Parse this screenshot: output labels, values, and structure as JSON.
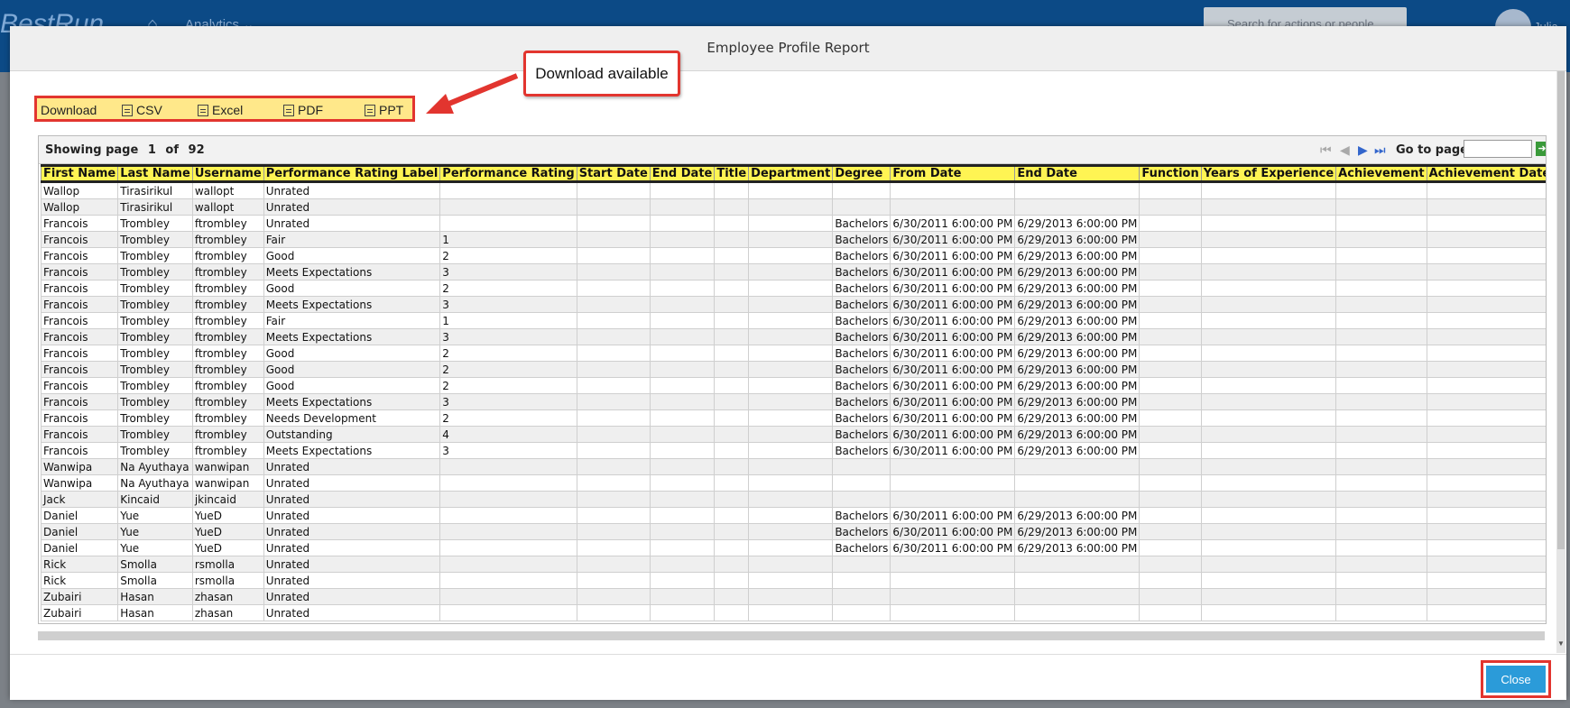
{
  "app": {
    "logo": "BestRun",
    "nav_label": "Analytics",
    "search_placeholder": "Search for actions or people",
    "user_name": "Julia M"
  },
  "dialog": {
    "title": "Employee Profile Report",
    "close_label": "Close"
  },
  "toolbar": {
    "download_label": "Download",
    "items": [
      "CSV",
      "Excel",
      "PDF",
      "PPT"
    ]
  },
  "callout": {
    "text": "Download available"
  },
  "paging": {
    "showing_label": "Showing page",
    "current_page": "1",
    "of_label": "of",
    "total_pages": "92",
    "goto_label": "Go to page:"
  },
  "table": {
    "columns": [
      "First Name",
      "Last Name",
      "Username",
      "Performance Rating Label",
      "Performance Rating",
      "Start Date",
      "End Date",
      "Title",
      "Department",
      "Degree",
      "From Date",
      "End Date",
      "Function",
      "Years of Experience",
      "Achievement",
      "Achievement Date"
    ],
    "rows": [
      [
        "Wallop",
        "Tirasirikul",
        "wallopt",
        "Unrated",
        "",
        "",
        "",
        "",
        "",
        "",
        "",
        "",
        "",
        "",
        "",
        ""
      ],
      [
        "Wallop",
        "Tirasirikul",
        "wallopt",
        "Unrated",
        "",
        "",
        "",
        "",
        "",
        "",
        "",
        "",
        "",
        "",
        "",
        ""
      ],
      [
        "Francois",
        "Trombley",
        "ftrombley",
        "Unrated",
        "",
        "",
        "",
        "",
        "",
        "Bachelors",
        "6/30/2011 6:00:00 PM",
        "6/29/2013 6:00:00 PM",
        "",
        "",
        "",
        ""
      ],
      [
        "Francois",
        "Trombley",
        "ftrombley",
        "Fair",
        "1",
        "",
        "",
        "",
        "",
        "Bachelors",
        "6/30/2011 6:00:00 PM",
        "6/29/2013 6:00:00 PM",
        "",
        "",
        "",
        ""
      ],
      [
        "Francois",
        "Trombley",
        "ftrombley",
        "Good",
        "2",
        "",
        "",
        "",
        "",
        "Bachelors",
        "6/30/2011 6:00:00 PM",
        "6/29/2013 6:00:00 PM",
        "",
        "",
        "",
        ""
      ],
      [
        "Francois",
        "Trombley",
        "ftrombley",
        "Meets Expectations",
        "3",
        "",
        "",
        "",
        "",
        "Bachelors",
        "6/30/2011 6:00:00 PM",
        "6/29/2013 6:00:00 PM",
        "",
        "",
        "",
        ""
      ],
      [
        "Francois",
        "Trombley",
        "ftrombley",
        "Good",
        "2",
        "",
        "",
        "",
        "",
        "Bachelors",
        "6/30/2011 6:00:00 PM",
        "6/29/2013 6:00:00 PM",
        "",
        "",
        "",
        ""
      ],
      [
        "Francois",
        "Trombley",
        "ftrombley",
        "Meets Expectations",
        "3",
        "",
        "",
        "",
        "",
        "Bachelors",
        "6/30/2011 6:00:00 PM",
        "6/29/2013 6:00:00 PM",
        "",
        "",
        "",
        ""
      ],
      [
        "Francois",
        "Trombley",
        "ftrombley",
        "Fair",
        "1",
        "",
        "",
        "",
        "",
        "Bachelors",
        "6/30/2011 6:00:00 PM",
        "6/29/2013 6:00:00 PM",
        "",
        "",
        "",
        ""
      ],
      [
        "Francois",
        "Trombley",
        "ftrombley",
        "Meets Expectations",
        "3",
        "",
        "",
        "",
        "",
        "Bachelors",
        "6/30/2011 6:00:00 PM",
        "6/29/2013 6:00:00 PM",
        "",
        "",
        "",
        ""
      ],
      [
        "Francois",
        "Trombley",
        "ftrombley",
        "Good",
        "2",
        "",
        "",
        "",
        "",
        "Bachelors",
        "6/30/2011 6:00:00 PM",
        "6/29/2013 6:00:00 PM",
        "",
        "",
        "",
        ""
      ],
      [
        "Francois",
        "Trombley",
        "ftrombley",
        "Good",
        "2",
        "",
        "",
        "",
        "",
        "Bachelors",
        "6/30/2011 6:00:00 PM",
        "6/29/2013 6:00:00 PM",
        "",
        "",
        "",
        ""
      ],
      [
        "Francois",
        "Trombley",
        "ftrombley",
        "Good",
        "2",
        "",
        "",
        "",
        "",
        "Bachelors",
        "6/30/2011 6:00:00 PM",
        "6/29/2013 6:00:00 PM",
        "",
        "",
        "",
        ""
      ],
      [
        "Francois",
        "Trombley",
        "ftrombley",
        "Meets Expectations",
        "3",
        "",
        "",
        "",
        "",
        "Bachelors",
        "6/30/2011 6:00:00 PM",
        "6/29/2013 6:00:00 PM",
        "",
        "",
        "",
        ""
      ],
      [
        "Francois",
        "Trombley",
        "ftrombley",
        "Needs Development",
        "2",
        "",
        "",
        "",
        "",
        "Bachelors",
        "6/30/2011 6:00:00 PM",
        "6/29/2013 6:00:00 PM",
        "",
        "",
        "",
        ""
      ],
      [
        "Francois",
        "Trombley",
        "ftrombley",
        "Outstanding",
        "4",
        "",
        "",
        "",
        "",
        "Bachelors",
        "6/30/2011 6:00:00 PM",
        "6/29/2013 6:00:00 PM",
        "",
        "",
        "",
        ""
      ],
      [
        "Francois",
        "Trombley",
        "ftrombley",
        "Meets Expectations",
        "3",
        "",
        "",
        "",
        "",
        "Bachelors",
        "6/30/2011 6:00:00 PM",
        "6/29/2013 6:00:00 PM",
        "",
        "",
        "",
        ""
      ],
      [
        "Wanwipa",
        "Na Ayuthaya",
        "wanwipan",
        "Unrated",
        "",
        "",
        "",
        "",
        "",
        "",
        "",
        "",
        "",
        "",
        "",
        ""
      ],
      [
        "Wanwipa",
        "Na Ayuthaya",
        "wanwipan",
        "Unrated",
        "",
        "",
        "",
        "",
        "",
        "",
        "",
        "",
        "",
        "",
        "",
        ""
      ],
      [
        "Jack",
        "Kincaid",
        "jkincaid",
        "Unrated",
        "",
        "",
        "",
        "",
        "",
        "",
        "",
        "",
        "",
        "",
        "",
        ""
      ],
      [
        "Daniel",
        "Yue",
        "YueD",
        "Unrated",
        "",
        "",
        "",
        "",
        "",
        "Bachelors",
        "6/30/2011 6:00:00 PM",
        "6/29/2013 6:00:00 PM",
        "",
        "",
        "",
        ""
      ],
      [
        "Daniel",
        "Yue",
        "YueD",
        "Unrated",
        "",
        "",
        "",
        "",
        "",
        "Bachelors",
        "6/30/2011 6:00:00 PM",
        "6/29/2013 6:00:00 PM",
        "",
        "",
        "",
        ""
      ],
      [
        "Daniel",
        "Yue",
        "YueD",
        "Unrated",
        "",
        "",
        "",
        "",
        "",
        "Bachelors",
        "6/30/2011 6:00:00 PM",
        "6/29/2013 6:00:00 PM",
        "",
        "",
        "",
        ""
      ],
      [
        "Rick",
        "Smolla",
        "rsmolla",
        "Unrated",
        "",
        "",
        "",
        "",
        "",
        "",
        "",
        "",
        "",
        "",
        "",
        ""
      ],
      [
        "Rick",
        "Smolla",
        "rsmolla",
        "Unrated",
        "",
        "",
        "",
        "",
        "",
        "",
        "",
        "",
        "",
        "",
        "",
        ""
      ],
      [
        "Zubairi",
        "Hasan",
        "zhasan",
        "Unrated",
        "",
        "",
        "",
        "",
        "",
        "",
        "",
        "",
        "",
        "",
        "",
        ""
      ],
      [
        "Zubairi",
        "Hasan",
        "zhasan",
        "Unrated",
        "",
        "",
        "",
        "",
        "",
        "",
        "",
        "",
        "",
        "",
        "",
        ""
      ]
    ]
  },
  "colors": {
    "header_bar": "#0c4a86",
    "table_header": "#fff453",
    "highlight": "#e2352f",
    "close_button": "#2b9bd9"
  }
}
